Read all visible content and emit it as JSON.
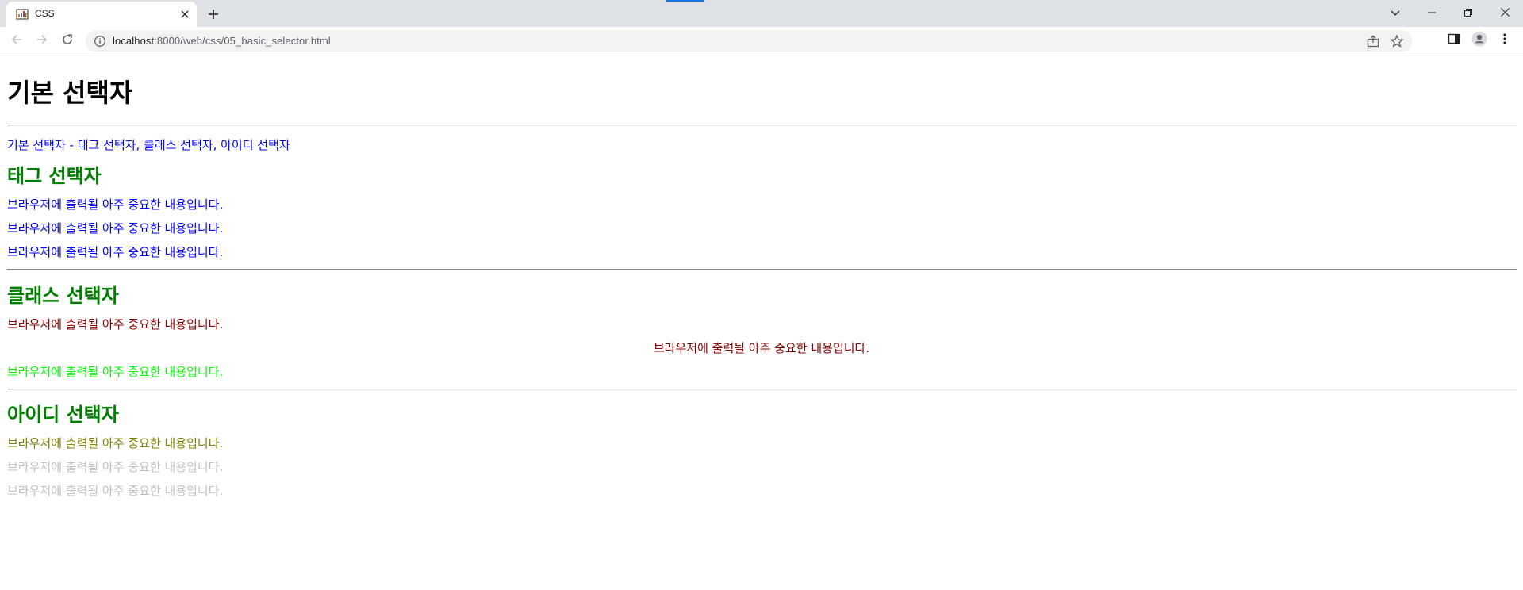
{
  "browser": {
    "tab_title": "CSS",
    "url_host": "localhost",
    "url_path": ":8000/web/css/05_basic_selector.html"
  },
  "page": {
    "heading": "기본 선택자",
    "intro": "기본 선택자 - 태그 선택자, 클래스 선택자, 아이디 선택자",
    "sections": {
      "tag": {
        "title": "태그 선택자",
        "lines": [
          "브라우저에 출력될 아주 중요한 내용입니다.",
          "브라우저에 출력될 아주 중요한 내용입니다.",
          "브라우저에 출력될 아주 중요한 내용입니다."
        ]
      },
      "class": {
        "title": "클래스 선택자",
        "lines": [
          "브라우저에 출력될 아주 중요한 내용입니다.",
          "브라우저에 출력될 아주 중요한 내용입니다.",
          "브라우저에 출력될 아주 중요한 내용입니다."
        ]
      },
      "id": {
        "title": "아이디 선택자",
        "lines": [
          "브라우저에 출력될 아주 중요한 내용입니다.",
          "브라우저에 출력될 아주 중요한 내용입니다.",
          "브라우저에 출력될 아주 중요한 내용입니다."
        ]
      }
    }
  },
  "colors": {
    "heading": "#000000",
    "intro": "#0000ff",
    "section_title": "#008000",
    "tag_line": "#0000ff",
    "class_line_1": "#8b0000",
    "class_line_2": "#8b0000",
    "class_line_3": "#00ff00",
    "id_line_1": "#808000",
    "id_line_2": "#c0c0c0",
    "id_line_3": "#c0c0c0"
  },
  "icons": {
    "favicon": "css-favicon-icon",
    "tab_close": "close-icon",
    "new_tab": "plus-icon",
    "back": "arrow-left-icon",
    "forward": "arrow-right-icon",
    "reload": "reload-icon",
    "site_info": "info-icon",
    "share": "share-icon",
    "bookmark": "star-icon",
    "side_panel": "side-panel-icon",
    "profile": "profile-icon",
    "menu": "kebab-menu-icon",
    "tab_search": "chevron-down-icon",
    "minimize": "minimize-icon",
    "restore": "restore-icon",
    "close_window": "close-window-icon"
  }
}
